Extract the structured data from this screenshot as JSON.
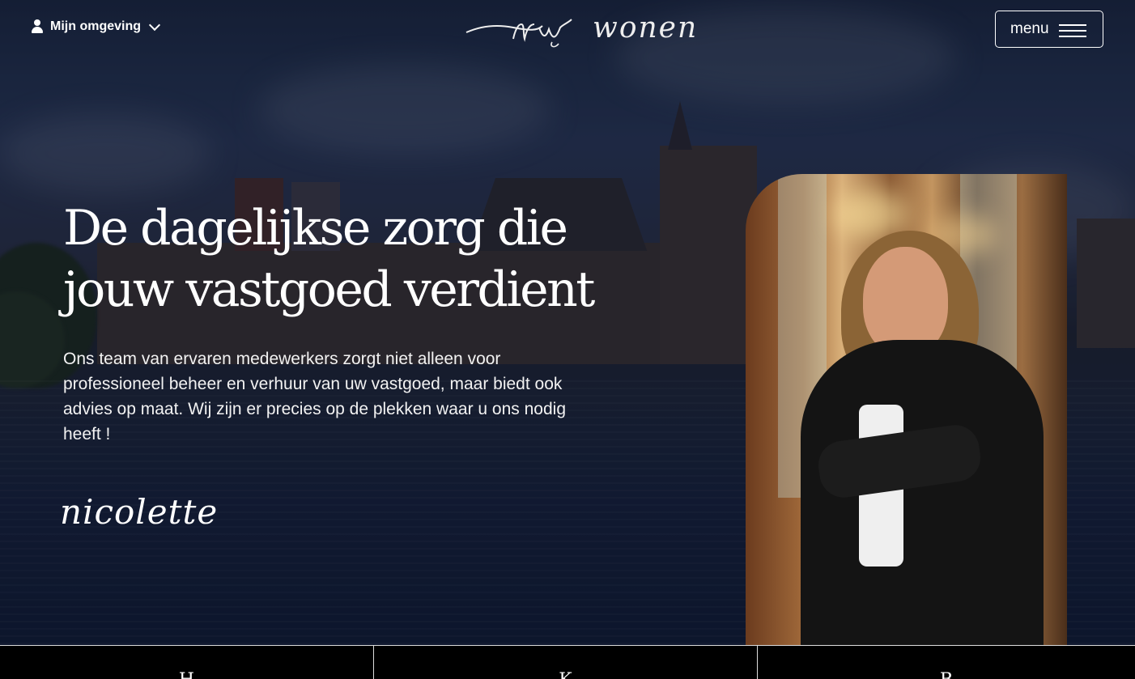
{
  "header": {
    "account_label": "Mijn omgeving",
    "account_icon": "user-icon",
    "logo_text": "wonen",
    "logo_script": "nrw",
    "menu_label": "menu"
  },
  "hero": {
    "headline": "De dagelijkse zorg die jouw vastgoed verdient",
    "intro": "Ons team van ervaren medewerkers zorgt niet alleen voor professioneel beheer en verhuur van uw vastgoed, maar biedt ook advies op maat. Wij zijn er precies op de plekken waar u ons nodig heeft !",
    "signature": "nicolette"
  },
  "tabs": [
    {
      "label": "H"
    },
    {
      "label": "K"
    },
    {
      "label": "B"
    }
  ],
  "colors": {
    "background": "#000000",
    "text": "#ffffff",
    "overlay": "#0a1022"
  }
}
